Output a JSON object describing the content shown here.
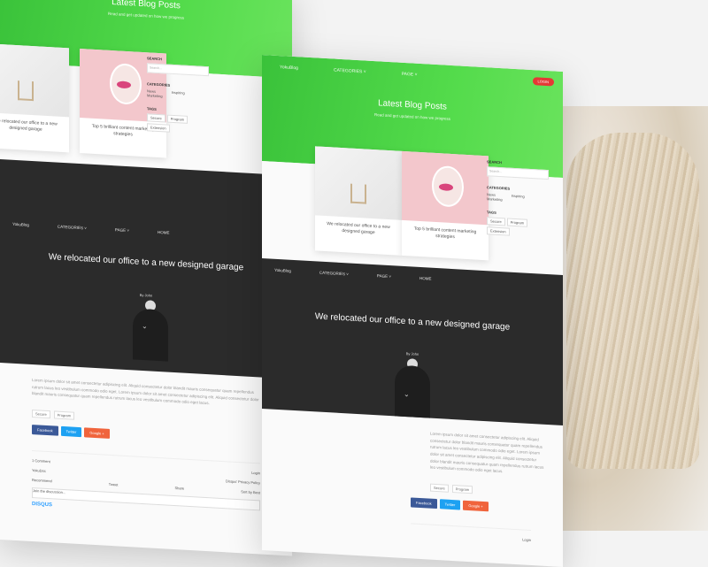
{
  "hero": {
    "title": "Latest Blog Posts",
    "subtitle": "Read and get updated on how we progress",
    "nav": [
      "YokuBlog",
      "CATEGORIES ˅",
      "PAGE ˅"
    ],
    "login_button": "LOGIN"
  },
  "sidebar": {
    "search_heading": "SEARCH",
    "search_placeholder": "Search...",
    "categories_heading": "CATEGORIES",
    "categories": [
      "News",
      "Marketing",
      "Inspiring"
    ],
    "tags_heading": "TAGS",
    "tags": [
      "Secure",
      "Program",
      "Extension"
    ]
  },
  "cards": [
    {
      "caption": "We relocated our office to a new designed garage"
    },
    {
      "caption": "Top 5 brilliant content marketing strategies"
    }
  ],
  "post": {
    "nav": [
      "YokuBlog",
      "CATEGORIES ˅",
      "PAGE ˅",
      "HOME"
    ],
    "title": "We relocated our office to a new designed garage",
    "author": "By John",
    "chevron": "⌄",
    "body": "Lorem ipsum dolor sit amet consectetur adipiscing elit. Aliquid consectetur dolor blandit mauris consequatur quam repellendus rutrum lacus leo vestibulum commodo odio eget. Lorem ipsum dolor sit amet consectetur adipiscing elit. Aliquid consectetur dolor blandit mauris consequatur quam repellendus rutrum lacus leo vestibulum commodo odio eget lacus.",
    "tags": [
      "Secure",
      "Program"
    ],
    "share": [
      "Facebook",
      "Twitter",
      "Google +"
    ]
  },
  "disqus": {
    "login": "Login",
    "comments": "1 Comment",
    "site": "YokuDoc",
    "privacy": "Disqus' Privacy Policy",
    "recommend": "Recommend",
    "tweet": "Tweet",
    "share": "Share",
    "sort": "Sort by Best",
    "join": "Join the discussion...",
    "brand": "DISQUS"
  }
}
